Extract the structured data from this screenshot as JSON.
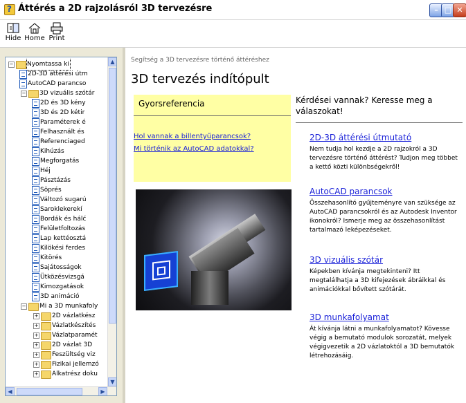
{
  "window": {
    "title": "Áttérés a 2D rajzolásról 3D tervezésre",
    "controls": [
      "minimize",
      "maximize",
      "close"
    ]
  },
  "toolbar": {
    "buttons": [
      {
        "label": "Hide",
        "icon": "hide-icon"
      },
      {
        "label": "Home",
        "icon": "home-icon"
      },
      {
        "label": "Print",
        "icon": "printer-icon"
      }
    ]
  },
  "sidebar": {
    "items": [
      {
        "level": 0,
        "kind": "folder",
        "expanded": true,
        "label": "Nyomtassa ki",
        "selected": true
      },
      {
        "level": 1,
        "kind": "page",
        "label": "2D-3D áttérési útm"
      },
      {
        "level": 1,
        "kind": "page",
        "label": "AutoCAD parancso"
      },
      {
        "level": 1,
        "kind": "folder",
        "expanded": true,
        "label": "3D vizuális szótár"
      },
      {
        "level": 2,
        "kind": "page",
        "label": "2D és 3D kény"
      },
      {
        "level": 2,
        "kind": "page",
        "label": "3D és 2D kétir"
      },
      {
        "level": 2,
        "kind": "page",
        "label": "Paraméterek é"
      },
      {
        "level": 2,
        "kind": "page",
        "label": "Felhasznált és"
      },
      {
        "level": 2,
        "kind": "page",
        "label": "Referenciaged"
      },
      {
        "level": 2,
        "kind": "page",
        "label": "Kihúzás"
      },
      {
        "level": 2,
        "kind": "page",
        "label": "Megforgatás"
      },
      {
        "level": 2,
        "kind": "page",
        "label": "Héj"
      },
      {
        "level": 2,
        "kind": "page",
        "label": "Pásztázás"
      },
      {
        "level": 2,
        "kind": "page",
        "label": "Söprés"
      },
      {
        "level": 2,
        "kind": "page",
        "label": "Változó sugarú"
      },
      {
        "level": 2,
        "kind": "page",
        "label": "Saroklekerekí"
      },
      {
        "level": 2,
        "kind": "page",
        "label": "Bordák és hálć"
      },
      {
        "level": 2,
        "kind": "page",
        "label": "Felületfoltozás"
      },
      {
        "level": 2,
        "kind": "page",
        "label": "Lap kettéosztá"
      },
      {
        "level": 2,
        "kind": "page",
        "label": "Kilökési ferdes"
      },
      {
        "level": 2,
        "kind": "page",
        "label": "Kitörés"
      },
      {
        "level": 2,
        "kind": "page",
        "label": "Sajátosságok"
      },
      {
        "level": 2,
        "kind": "page",
        "label": "Ütközésvizsgá"
      },
      {
        "level": 2,
        "kind": "page",
        "label": "Kimozgatások"
      },
      {
        "level": 2,
        "kind": "page",
        "label": "3D animáció"
      },
      {
        "level": 1,
        "kind": "folder",
        "expanded": true,
        "label": "Mi a 3D munkafoly"
      },
      {
        "level": 2,
        "kind": "folder",
        "expanded": false,
        "label": "2D vázlatkész"
      },
      {
        "level": 2,
        "kind": "folder",
        "expanded": false,
        "label": "Vázlatkészítés"
      },
      {
        "level": 2,
        "kind": "folder",
        "expanded": false,
        "label": "Vázlatparamét"
      },
      {
        "level": 2,
        "kind": "folder",
        "expanded": false,
        "label": "2D vázlat 3D"
      },
      {
        "level": 2,
        "kind": "folder",
        "expanded": false,
        "label": "Feszültség viz"
      },
      {
        "level": 2,
        "kind": "folder",
        "expanded": false,
        "label": "Fizikai jellemzó"
      },
      {
        "level": 2,
        "kind": "folder",
        "expanded": false,
        "label": "Alkatrész doku"
      }
    ]
  },
  "content": {
    "breadcrumb": "Segítség a 3D tervezésre történő áttéréshez",
    "title": "3D tervezés indítópult",
    "quick_reference": {
      "title": "Gyorsreferencia",
      "links": [
        "Hol vannak a billentyűparancsok?",
        "Mi történik az AutoCAD adatokkal?"
      ]
    },
    "question": "Kérdései vannak? Keresse meg a válaszokat!",
    "sections": [
      {
        "title": "2D-3D áttérési útmutató",
        "text": "Nem tudja hol kezdje a 2D rajzokról a 3D tervezésre történő áttérést? Tudjon meg többet a kettő közti különbségekről!"
      },
      {
        "title": "AutoCAD parancsok",
        "text": "Összehasonlító gyűjteményre van szüksége az AutoCAD parancsokról és az Autodesk Inventor ikonokról? Ismerje meg az összehasonlítást tartalmazó leképezéseket."
      },
      {
        "title": "3D vizuális szótár",
        "text": "Képekben kívánja megtekinteni? Itt megtalálhatja a 3D kifejezések ábráikkal és animációkkal bővített szótárát."
      },
      {
        "title": "3D munkafolyamat",
        "text": "Át kívánja látni a munkafolyamatot? Kövesse végig a bemutató modulok sorozatát, melyek végigvezetik a 2D vázlatoktól a 3D bemutatók létrehozásáig."
      }
    ]
  }
}
